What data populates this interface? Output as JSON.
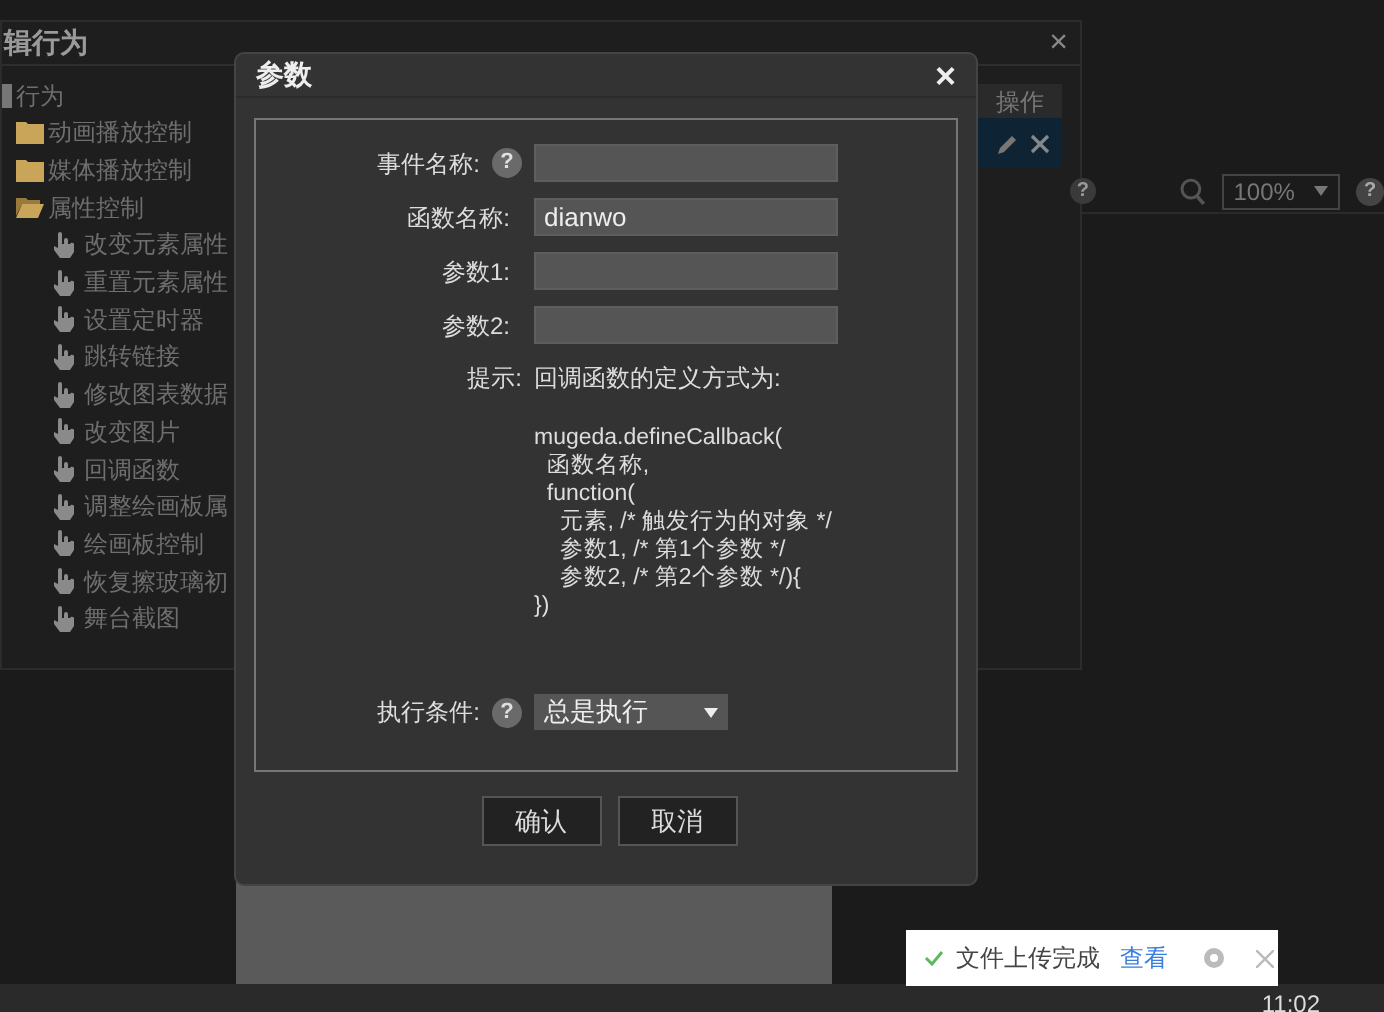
{
  "background_window": {
    "title": "辑行为",
    "close": "×",
    "tree": {
      "label": "行为",
      "children": [
        {
          "label": "动画播放控制",
          "kind": "folder",
          "expanded": false
        },
        {
          "label": "媒体播放控制",
          "kind": "folder",
          "expanded": false
        },
        {
          "label": "属性控制",
          "kind": "folder",
          "expanded": true,
          "children": [
            {
              "label": "改变元素属性",
              "kind": "action"
            },
            {
              "label": "重置元素属性",
              "kind": "action"
            },
            {
              "label": "设置定时器",
              "kind": "action"
            },
            {
              "label": "跳转链接",
              "kind": "action"
            },
            {
              "label": "修改图表数据",
              "kind": "action"
            },
            {
              "label": "改变图片",
              "kind": "action"
            },
            {
              "label": "回调函数",
              "kind": "action"
            },
            {
              "label": "调整绘画板属",
              "kind": "action"
            },
            {
              "label": "绘画板控制",
              "kind": "action"
            },
            {
              "label": "恢复擦玻璃初",
              "kind": "action"
            },
            {
              "label": "舞台截图",
              "kind": "action"
            }
          ]
        }
      ]
    },
    "table": {
      "columns": [
        "操作"
      ],
      "rows": [
        {
          "selected": true
        }
      ]
    }
  },
  "toolbar": {
    "help": "?",
    "zoom": "100%",
    "help_right": "?"
  },
  "dialog": {
    "title": "参数",
    "close": "×",
    "fields": [
      {
        "label": "事件名称:",
        "help": "?"
      },
      {
        "label": "函数名称:",
        "value": "dianwo"
      },
      {
        "label": "参数1:"
      },
      {
        "label": "参数2:"
      }
    ],
    "hint": {
      "label": "提示:",
      "text": "回调函数的定义方式为:",
      "code": [
        "mugeda.defineCallback(",
        "  函数名称,",
        "  function(",
        "    元素, /* 触发行为的对象 */",
        "    参数1, /* 第1个参数 */",
        "    参数2, /* 第2个参数 */){",
        "})"
      ]
    },
    "condition": {
      "label": "执行条件:",
      "help": "?",
      "value": "总是执行"
    },
    "buttons": [
      "确认",
      "取消"
    ]
  },
  "notification": {
    "message": "文件上传完成",
    "link": "查看"
  },
  "taskbar": {
    "time": "11:02"
  }
}
